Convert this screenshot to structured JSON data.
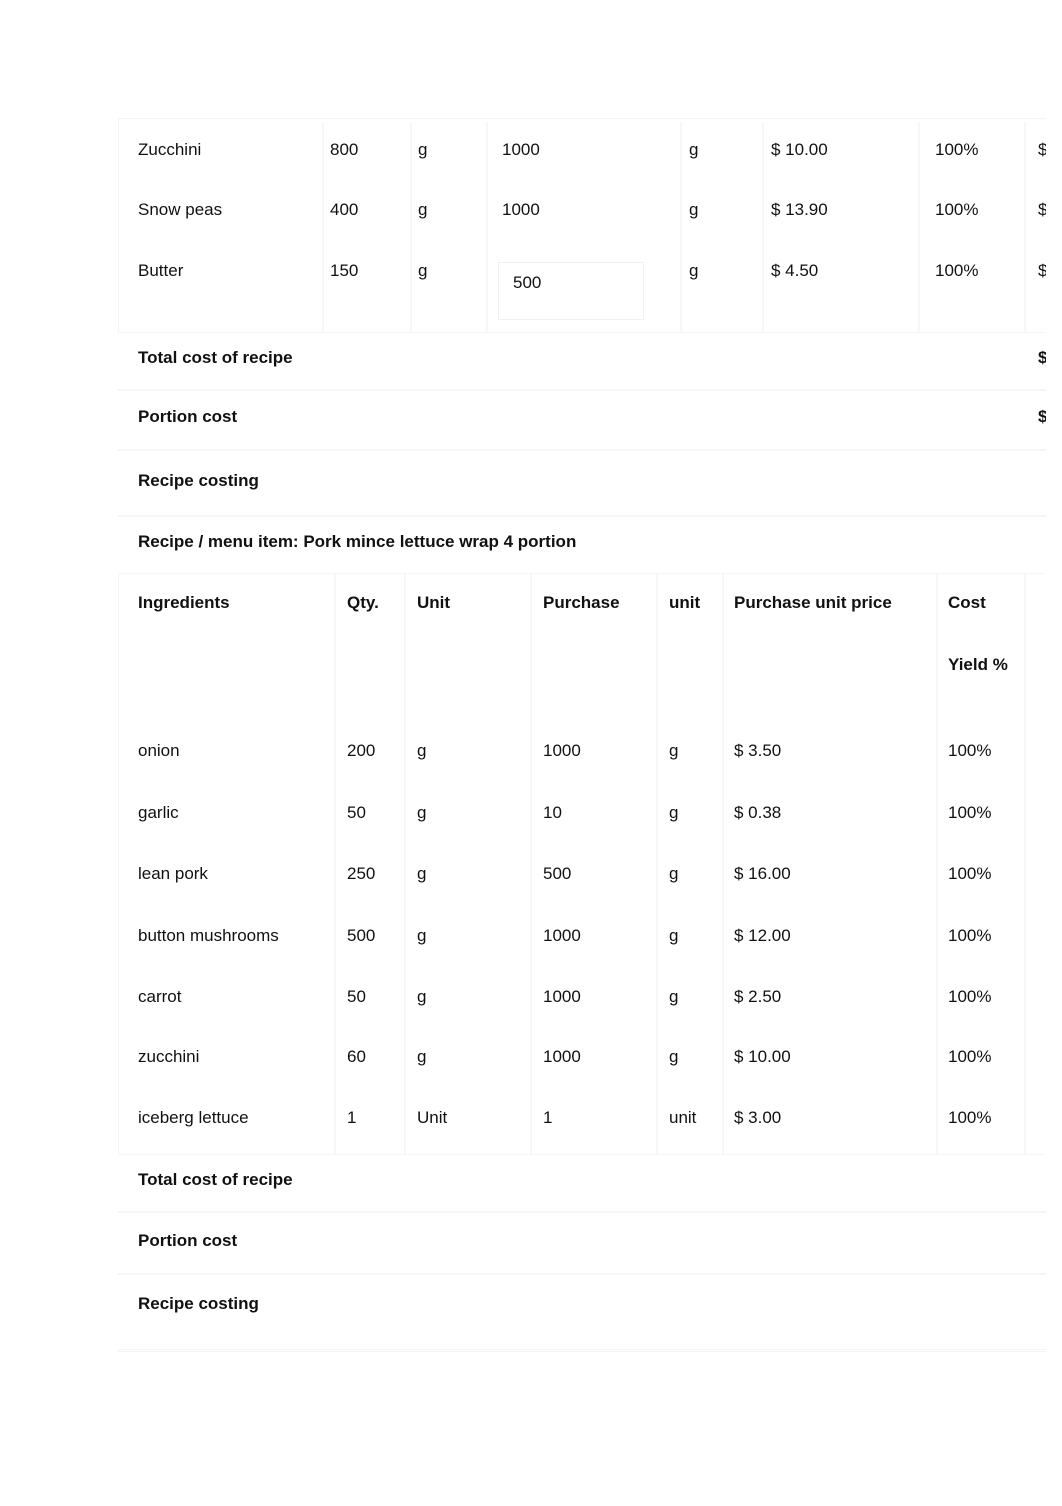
{
  "table1": {
    "rows": [
      {
        "ingredient": "Zucchini",
        "qty": "800",
        "unit": "g",
        "purchase": "1000",
        "purchase_unit": "g",
        "price": "$ 10.00",
        "yield": "100%",
        "cost": "$"
      },
      {
        "ingredient": "Snow peas",
        "qty": "400",
        "unit": "g",
        "purchase": "1000",
        "purchase_unit": "g",
        "price": "$ 13.90",
        "yield": "100%",
        "cost": "$"
      },
      {
        "ingredient": "Butter",
        "qty": "150",
        "unit": "g",
        "purchase": "500",
        "purchase_unit": "g",
        "price": "$ 4.50",
        "yield": "100%",
        "cost": "$"
      }
    ],
    "total_label": "Total cost of recipe",
    "total_value": "$",
    "portion_label": "Portion cost",
    "portion_value": "$",
    "costing_label": "Recipe costing"
  },
  "table2": {
    "title": "Recipe / menu item: Pork mince lettuce wrap 4 portion",
    "headers": {
      "ingredients": "Ingredients",
      "qty": "Qty.",
      "unit": "Unit",
      "purchase": "Purchase",
      "purchase_unit": "unit",
      "price": "Purchase unit price",
      "cost": "Cost",
      "yield": "Yield %"
    },
    "rows": [
      {
        "ingredient": "onion",
        "qty": "200",
        "unit": "g",
        "purchase": "1000",
        "purchase_unit": "g",
        "price": "$ 3.50",
        "yield": "100%"
      },
      {
        "ingredient": "garlic",
        "qty": "50",
        "unit": "g",
        "purchase": "10",
        "purchase_unit": "g",
        "price": "$ 0.38",
        "yield": "100%"
      },
      {
        "ingredient": "lean pork",
        "qty": "250",
        "unit": "g",
        "purchase": "500",
        "purchase_unit": "g",
        "price": "$ 16.00",
        "yield": "100%"
      },
      {
        "ingredient": "button mushrooms",
        "qty": "500",
        "unit": "g",
        "purchase": "1000",
        "purchase_unit": "g",
        "price": "$ 12.00",
        "yield": "100%"
      },
      {
        "ingredient": "carrot",
        "qty": "50",
        "unit": "g",
        "purchase": "1000",
        "purchase_unit": "g",
        "price": "$ 2.50",
        "yield": "100%"
      },
      {
        "ingredient": "zucchini",
        "qty": "60",
        "unit": "g",
        "purchase": "1000",
        "purchase_unit": "g",
        "price": "$ 10.00",
        "yield": "100%"
      },
      {
        "ingredient": "iceberg lettuce",
        "qty": "1",
        "unit": "Unit",
        "purchase": "1",
        "purchase_unit": "unit",
        "price": "$ 3.00",
        "yield": "100%"
      }
    ],
    "total_label": "Total cost of recipe",
    "portion_label": "Portion cost",
    "costing_label": "Recipe costing"
  }
}
